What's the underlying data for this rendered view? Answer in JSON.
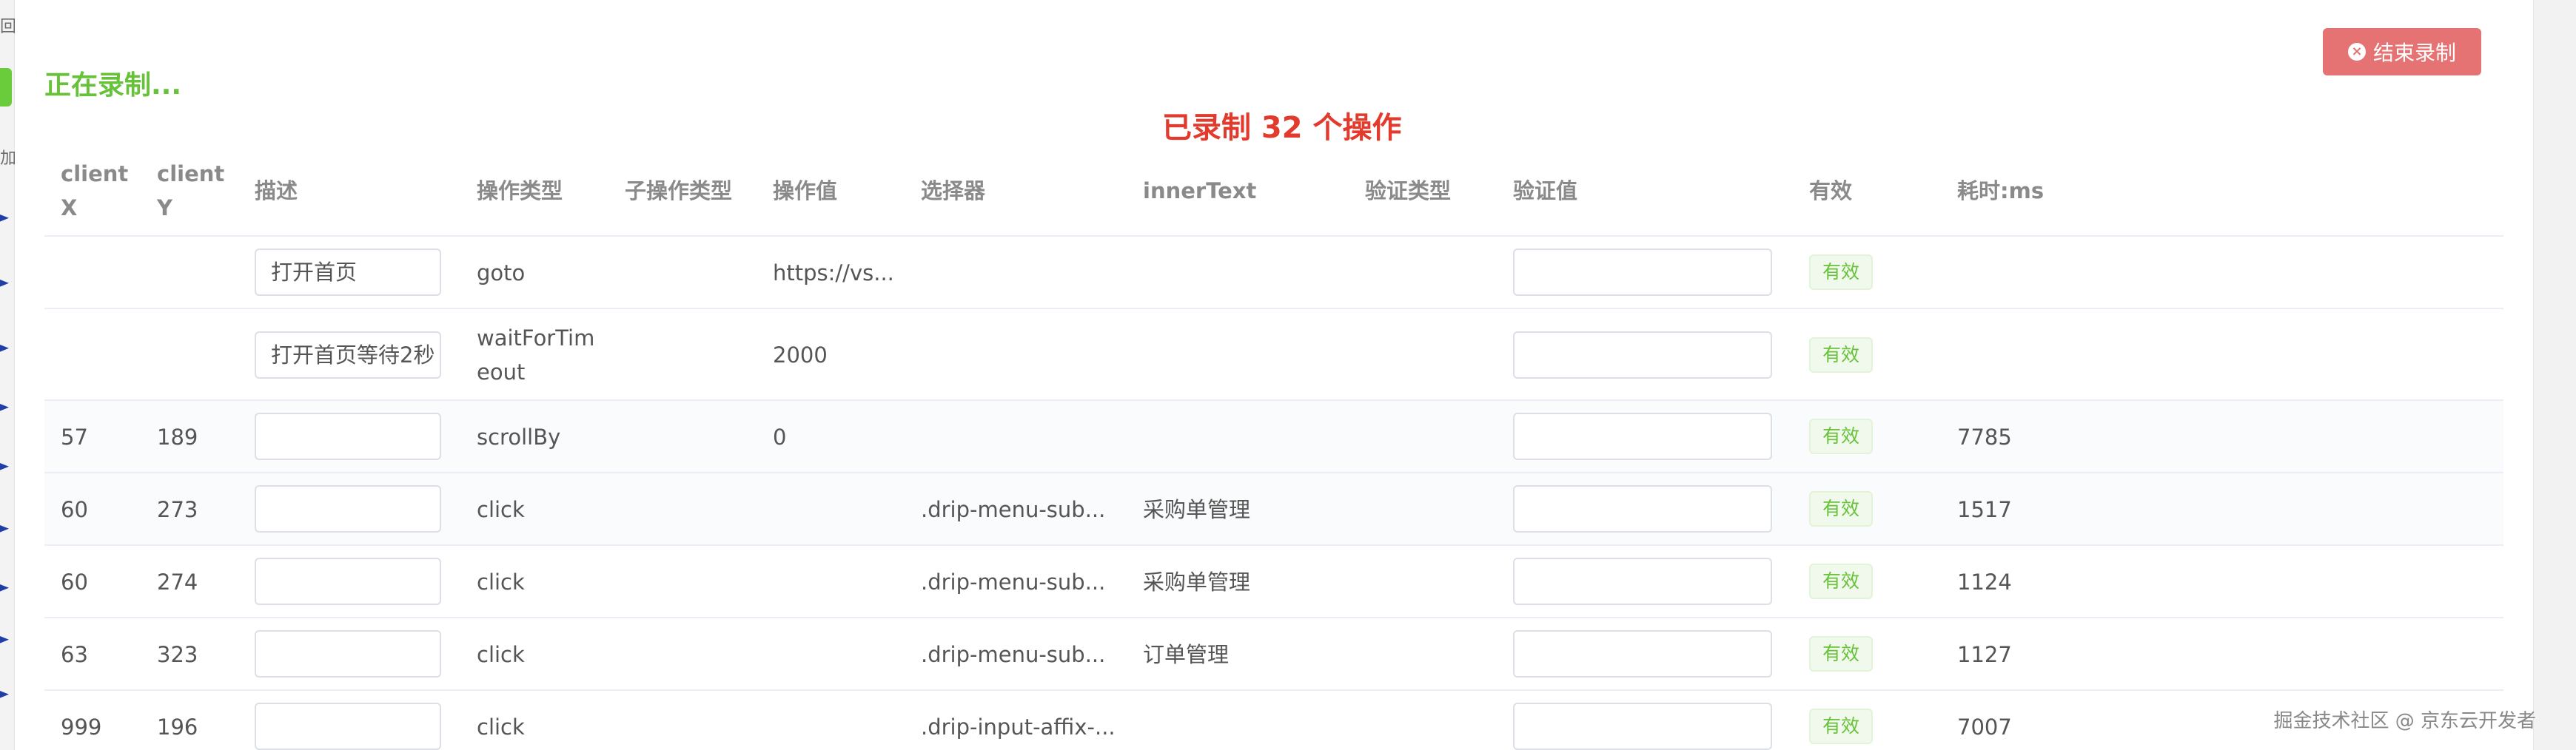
{
  "background": {
    "left_text_top": "回",
    "left_text_mid": "加"
  },
  "modal": {
    "status_text": "正在录制...",
    "op_count_text": "已录制 32 个操作",
    "end_button_label": "结束录制"
  },
  "table": {
    "headers": {
      "client_x": "client X",
      "client_y": "client Y",
      "desc": "描述",
      "op_type": "操作类型",
      "sub_op_type": "子操作类型",
      "op_value": "操作值",
      "selector": "选择器",
      "inner_text": "innerText",
      "verify_type": "验证类型",
      "verify_value": "验证值",
      "valid": "有效",
      "elapsed": "耗时:ms"
    },
    "rows": [
      {
        "client_x": "",
        "client_y": "",
        "desc": "打开首页",
        "op_type": "goto",
        "sub_op_type": "",
        "op_value": "https://vs...",
        "selector": "",
        "inner_text": "",
        "verify_type": "",
        "verify_value": "",
        "valid": "有效",
        "elapsed": ""
      },
      {
        "client_x": "",
        "client_y": "",
        "desc": "打开首页等待2秒",
        "op_type": "waitForTimeout",
        "sub_op_type": "",
        "op_value": "2000",
        "selector": "",
        "inner_text": "",
        "verify_type": "",
        "verify_value": "",
        "valid": "有效",
        "elapsed": ""
      },
      {
        "client_x": "57",
        "client_y": "189",
        "desc": "",
        "op_type": "scrollBy",
        "sub_op_type": "",
        "op_value": "0",
        "selector": "",
        "inner_text": "",
        "verify_type": "",
        "verify_value": "",
        "valid": "有效",
        "elapsed": "7785"
      },
      {
        "client_x": "60",
        "client_y": "273",
        "desc": "",
        "op_type": "click",
        "sub_op_type": "",
        "op_value": "",
        "selector": ".drip-menu-sub...",
        "inner_text": "采购单管理",
        "verify_type": "",
        "verify_value": "",
        "valid": "有效",
        "elapsed": "1517"
      },
      {
        "client_x": "60",
        "client_y": "274",
        "desc": "",
        "op_type": "click",
        "sub_op_type": "",
        "op_value": "",
        "selector": ".drip-menu-sub...",
        "inner_text": "采购单管理",
        "verify_type": "",
        "verify_value": "",
        "valid": "有效",
        "elapsed": "1124"
      },
      {
        "client_x": "63",
        "client_y": "323",
        "desc": "",
        "op_type": "click",
        "sub_op_type": "",
        "op_value": "",
        "selector": ".drip-menu-sub...",
        "inner_text": "订单管理",
        "verify_type": "",
        "verify_value": "",
        "valid": "有效",
        "elapsed": "1127"
      },
      {
        "client_x": "999",
        "client_y": "196",
        "desc": "",
        "op_type": "click",
        "sub_op_type": "",
        "op_value": "",
        "selector": ".drip-input-affix-...",
        "inner_text": "",
        "verify_type": "",
        "verify_value": "",
        "valid": "有效",
        "elapsed": "7007"
      }
    ]
  },
  "watermark": "掘金技术社区 @ 京东云开发者",
  "icons": {
    "end_button": "close-circle-icon",
    "background_flag": "flag-icon"
  },
  "colors": {
    "recording_green": "#67c23a",
    "count_red": "#e23a2c",
    "end_button_bg": "#e57373",
    "badge_bg": "#f0f9eb",
    "badge_text": "#67c23a"
  }
}
